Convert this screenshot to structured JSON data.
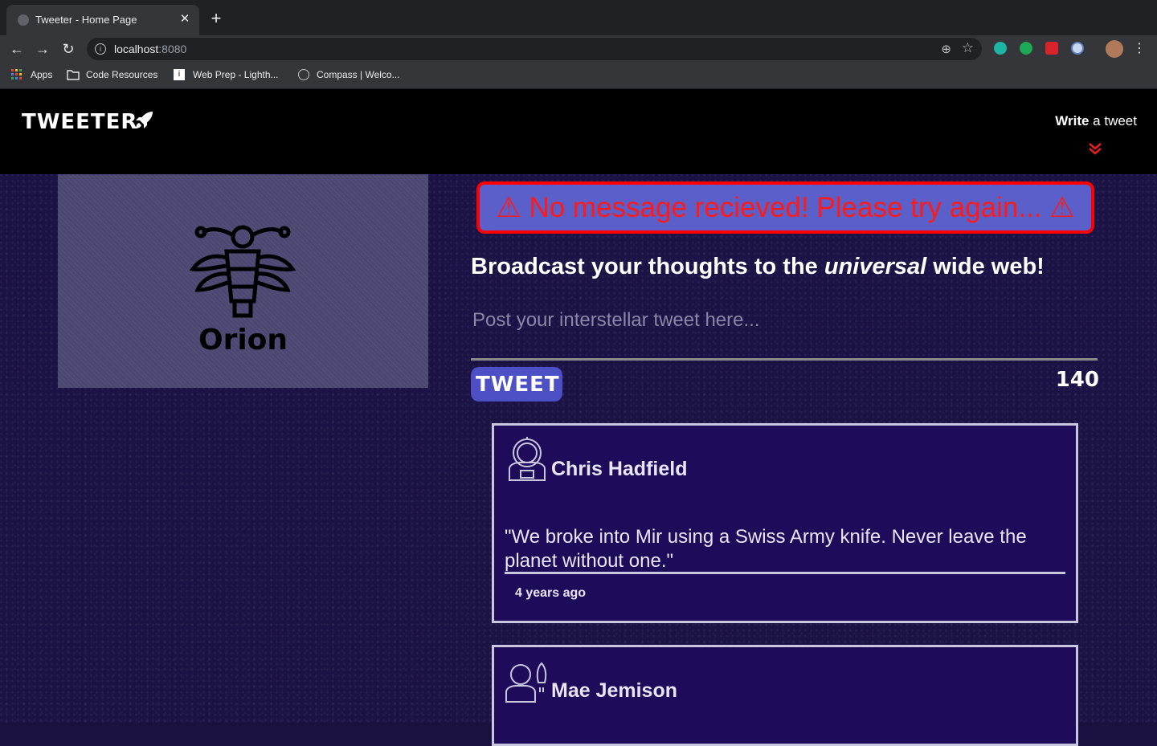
{
  "browser": {
    "tab_title": "Tweeter - Home Page",
    "tab_close": "✕",
    "new_tab": "+",
    "url_host": "localhost",
    "url_port": ":8080",
    "bookmarks": [
      {
        "label": "Apps"
      },
      {
        "label": "Code Resources"
      },
      {
        "label": "Web Prep - Lighth..."
      },
      {
        "label": "Compass | Welco..."
      }
    ]
  },
  "nav": {
    "brand": "TWEETER",
    "compose_bold": "Write",
    "compose_rest": " a tweet"
  },
  "profile": {
    "name": "Orion"
  },
  "error": {
    "message": "⚠ No message recieved! Please try again... ⚠"
  },
  "composer": {
    "headline_start": "Broadcast your thoughts to the ",
    "headline_italic": "universal",
    "headline_end": " wide web!",
    "placeholder": "Post your interstellar tweet here...",
    "button_label": "TWEET",
    "counter": "140"
  },
  "tweets": [
    {
      "author": "Chris Hadfield",
      "text": "\"We broke into Mir using a Swiss Army knife. Never leave the planet without one.\"",
      "time": "4 years ago"
    },
    {
      "author": "Mae Jemison"
    }
  ],
  "colors": {
    "accent": "#4d4fc4",
    "error": "#ff0000",
    "card_bg": "#1e0b5a",
    "page_bg": "#1b1245"
  }
}
